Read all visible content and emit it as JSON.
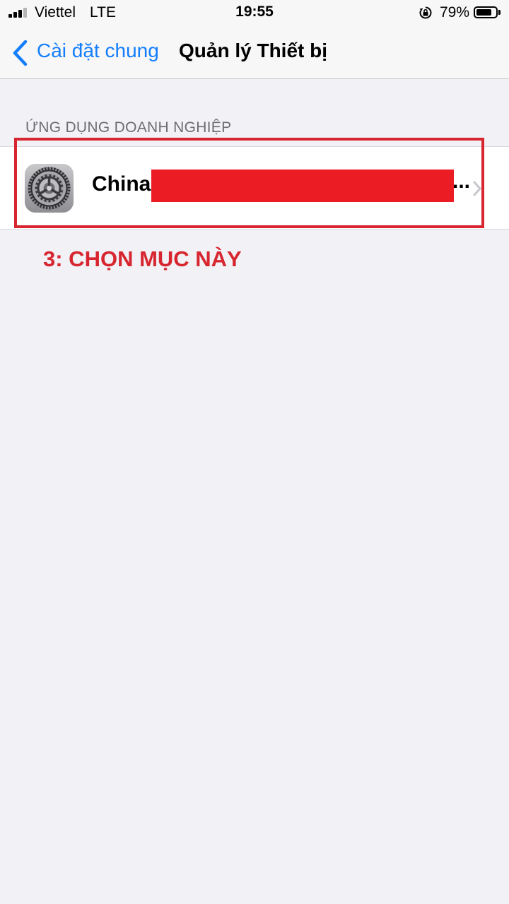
{
  "status_bar": {
    "carrier": "Viettel",
    "network": "LTE",
    "time": "19:55",
    "battery_percent": "79%",
    "battery_level": 0.79,
    "icons": [
      "signal-bars-icon",
      "rotation-lock-icon",
      "battery-icon"
    ]
  },
  "nav": {
    "back_label": "Cài đặt chung",
    "title": "Quản lý Thiết bị",
    "accent_color": "#147efb"
  },
  "section": {
    "header": "ỨNG DỤNG DOANH NGHIỆP",
    "items": [
      {
        "name": "China",
        "truncated_suffix": "...",
        "icon": "settings-gear-icon"
      }
    ]
  },
  "annotation": {
    "text": "3: CHỌN MỤC NÀY",
    "color": "#d7262f"
  }
}
